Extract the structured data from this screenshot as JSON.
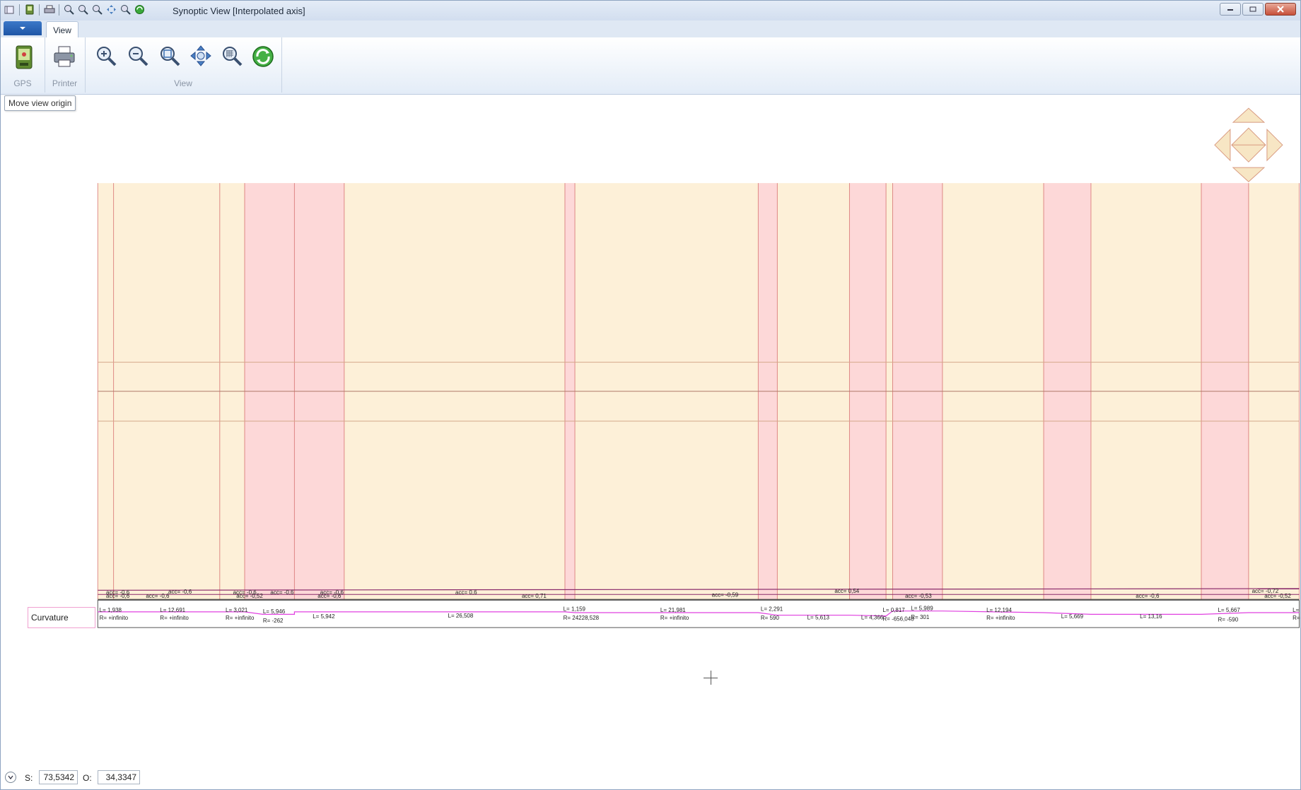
{
  "window": {
    "title": "Synoptic View [Interpolated axis]"
  },
  "tabs": [
    {
      "label": "View"
    }
  ],
  "ribbon": {
    "gps_label": "GPS",
    "printer_label": "Printer",
    "view_group_label": "View"
  },
  "tooltip": "Move view origin",
  "curvature_label": "Curvature",
  "bands": {
    "pink_ranges": [
      [
        294,
        354
      ],
      [
        354,
        414
      ],
      [
        680,
        692
      ],
      [
        913,
        936
      ],
      [
        1023,
        1067
      ],
      [
        1075,
        1135
      ],
      [
        1257,
        1314
      ],
      [
        1447,
        1504
      ]
    ],
    "divider_lines": [
      117,
      136,
      264,
      294,
      354,
      414,
      680,
      692,
      913,
      936,
      1023,
      1067,
      1075,
      1135,
      1257,
      1314,
      1447,
      1504,
      1565
    ]
  },
  "acc_labels": [
    {
      "text": "acc= -0,6"
    },
    {
      "text": "acc= -0,6"
    },
    {
      "text": "acc= -0,6"
    },
    {
      "text": "acc= -0,6"
    },
    {
      "text": "acc= -0,6"
    },
    {
      "text": "acc= -0,52"
    },
    {
      "text": "acc= -0,6"
    },
    {
      "text": "acc= -0,6"
    },
    {
      "text": "acc= 0,6"
    },
    {
      "text": "acc= -0,6"
    },
    {
      "text": "acc= 0,71"
    },
    {
      "text": "acc= -0,59"
    },
    {
      "text": "acc= 0,54"
    },
    {
      "text": "acc= -0,53"
    },
    {
      "text": "acc= -0,6"
    },
    {
      "text": "acc= -0,72"
    },
    {
      "text": "acc= -0,52"
    }
  ],
  "curvature_items": [
    {
      "l": "L= 1,938",
      "r": "R= +infinito"
    },
    {
      "l": "L= 12,691",
      "r": "R= +infinito"
    },
    {
      "l": "L= 3,021",
      "r": "R= +infinito"
    },
    {
      "l": "L= 5,946",
      "r": "R= -262"
    },
    {
      "l": "L= 5,942",
      "r": ""
    },
    {
      "l": "L= 26,508",
      "r": ""
    },
    {
      "l": "L= 1,159",
      "r": "R= 24228,528"
    },
    {
      "l": "L= 21,981",
      "r": "R= +infinito"
    },
    {
      "l": "L= 2,291",
      "r": "R= 590"
    },
    {
      "l": "L= 5,613",
      "r": ""
    },
    {
      "l": "L= 4,366",
      "r": ""
    },
    {
      "l": "L= 0,817",
      "r": "R= -656,048"
    },
    {
      "l": "L= 5,989",
      "r": "R= 301"
    },
    {
      "l": "L= 12,194",
      "r": "R= +infinito"
    },
    {
      "l": "L= 5,669",
      "r": ""
    },
    {
      "l": "L= 13,16",
      "r": ""
    },
    {
      "l": "L= 5,667",
      "r": "R= -590"
    },
    {
      "l": "L=",
      "r": "R="
    }
  ],
  "status": {
    "s_label": "S:",
    "s_value": "73,5342",
    "o_label": "O:",
    "o_value": "34,3347"
  },
  "colors": {
    "band_base": "#fdf0d8",
    "band_pink": "#fdd8d8",
    "divider": "#d46a6a",
    "curvature_line": "#e040e0",
    "nav_arrow_fill": "#f7e6c4",
    "nav_arrow_stroke": "#d89a80"
  }
}
